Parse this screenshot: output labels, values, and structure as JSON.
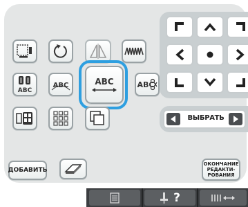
{
  "toolbar": {
    "add_label": "ДОБАВИТЬ",
    "finish_label_lines": [
      "ОКОНЧАНИЕ",
      "РЕДАКТИ-",
      "РОВАНИЯ"
    ]
  },
  "text_buttons": {
    "arc_text": "ABC",
    "spacing_text": "ABC",
    "spacing_selected": true,
    "split_text": "ABC",
    "icon_font_text": "ABC"
  },
  "select_bar": {
    "label": "ВЫБРАТЬ"
  },
  "bottom_bar": {
    "tabs": [
      "list-icon",
      "needle-help-icon",
      "thread-length-icon"
    ],
    "help_mark": "?"
  },
  "colors": {
    "panel_bg": "#e4e6e6",
    "selection_border": "#2e9fe0",
    "bottom_bar": "#3b3d40"
  }
}
